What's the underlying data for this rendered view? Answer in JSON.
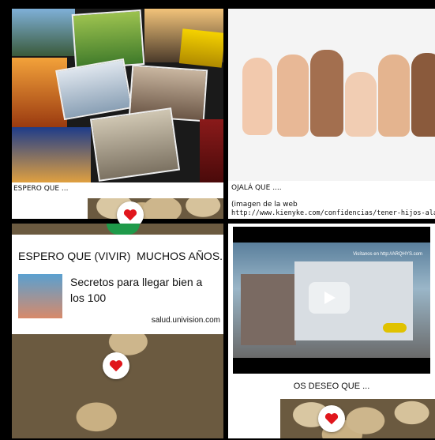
{
  "cards": [
    {
      "caption": "ESPERO QUE ..."
    },
    {
      "caption": "OJALÁ QUE ....",
      "note": "(imagen de la web",
      "link": "http://www.kienyke.com/confidencias/tener-hijos-alarga-la"
    },
    {
      "text": "ESPERO QUE (VIVIR)  MUCHOS AÑOS.",
      "link_title": "Secretos para llegar bien a los 100",
      "link_domain": "salud.univision.com"
    },
    {
      "caption": "OS DESEO QUE ...",
      "video_watermark": "Visítanos en http://ARQHYS.com"
    }
  ],
  "colors": {
    "heart": "#e0161c",
    "accent_green": "#1f9a4a"
  },
  "icons": [
    "heart-icon",
    "play-icon"
  ]
}
